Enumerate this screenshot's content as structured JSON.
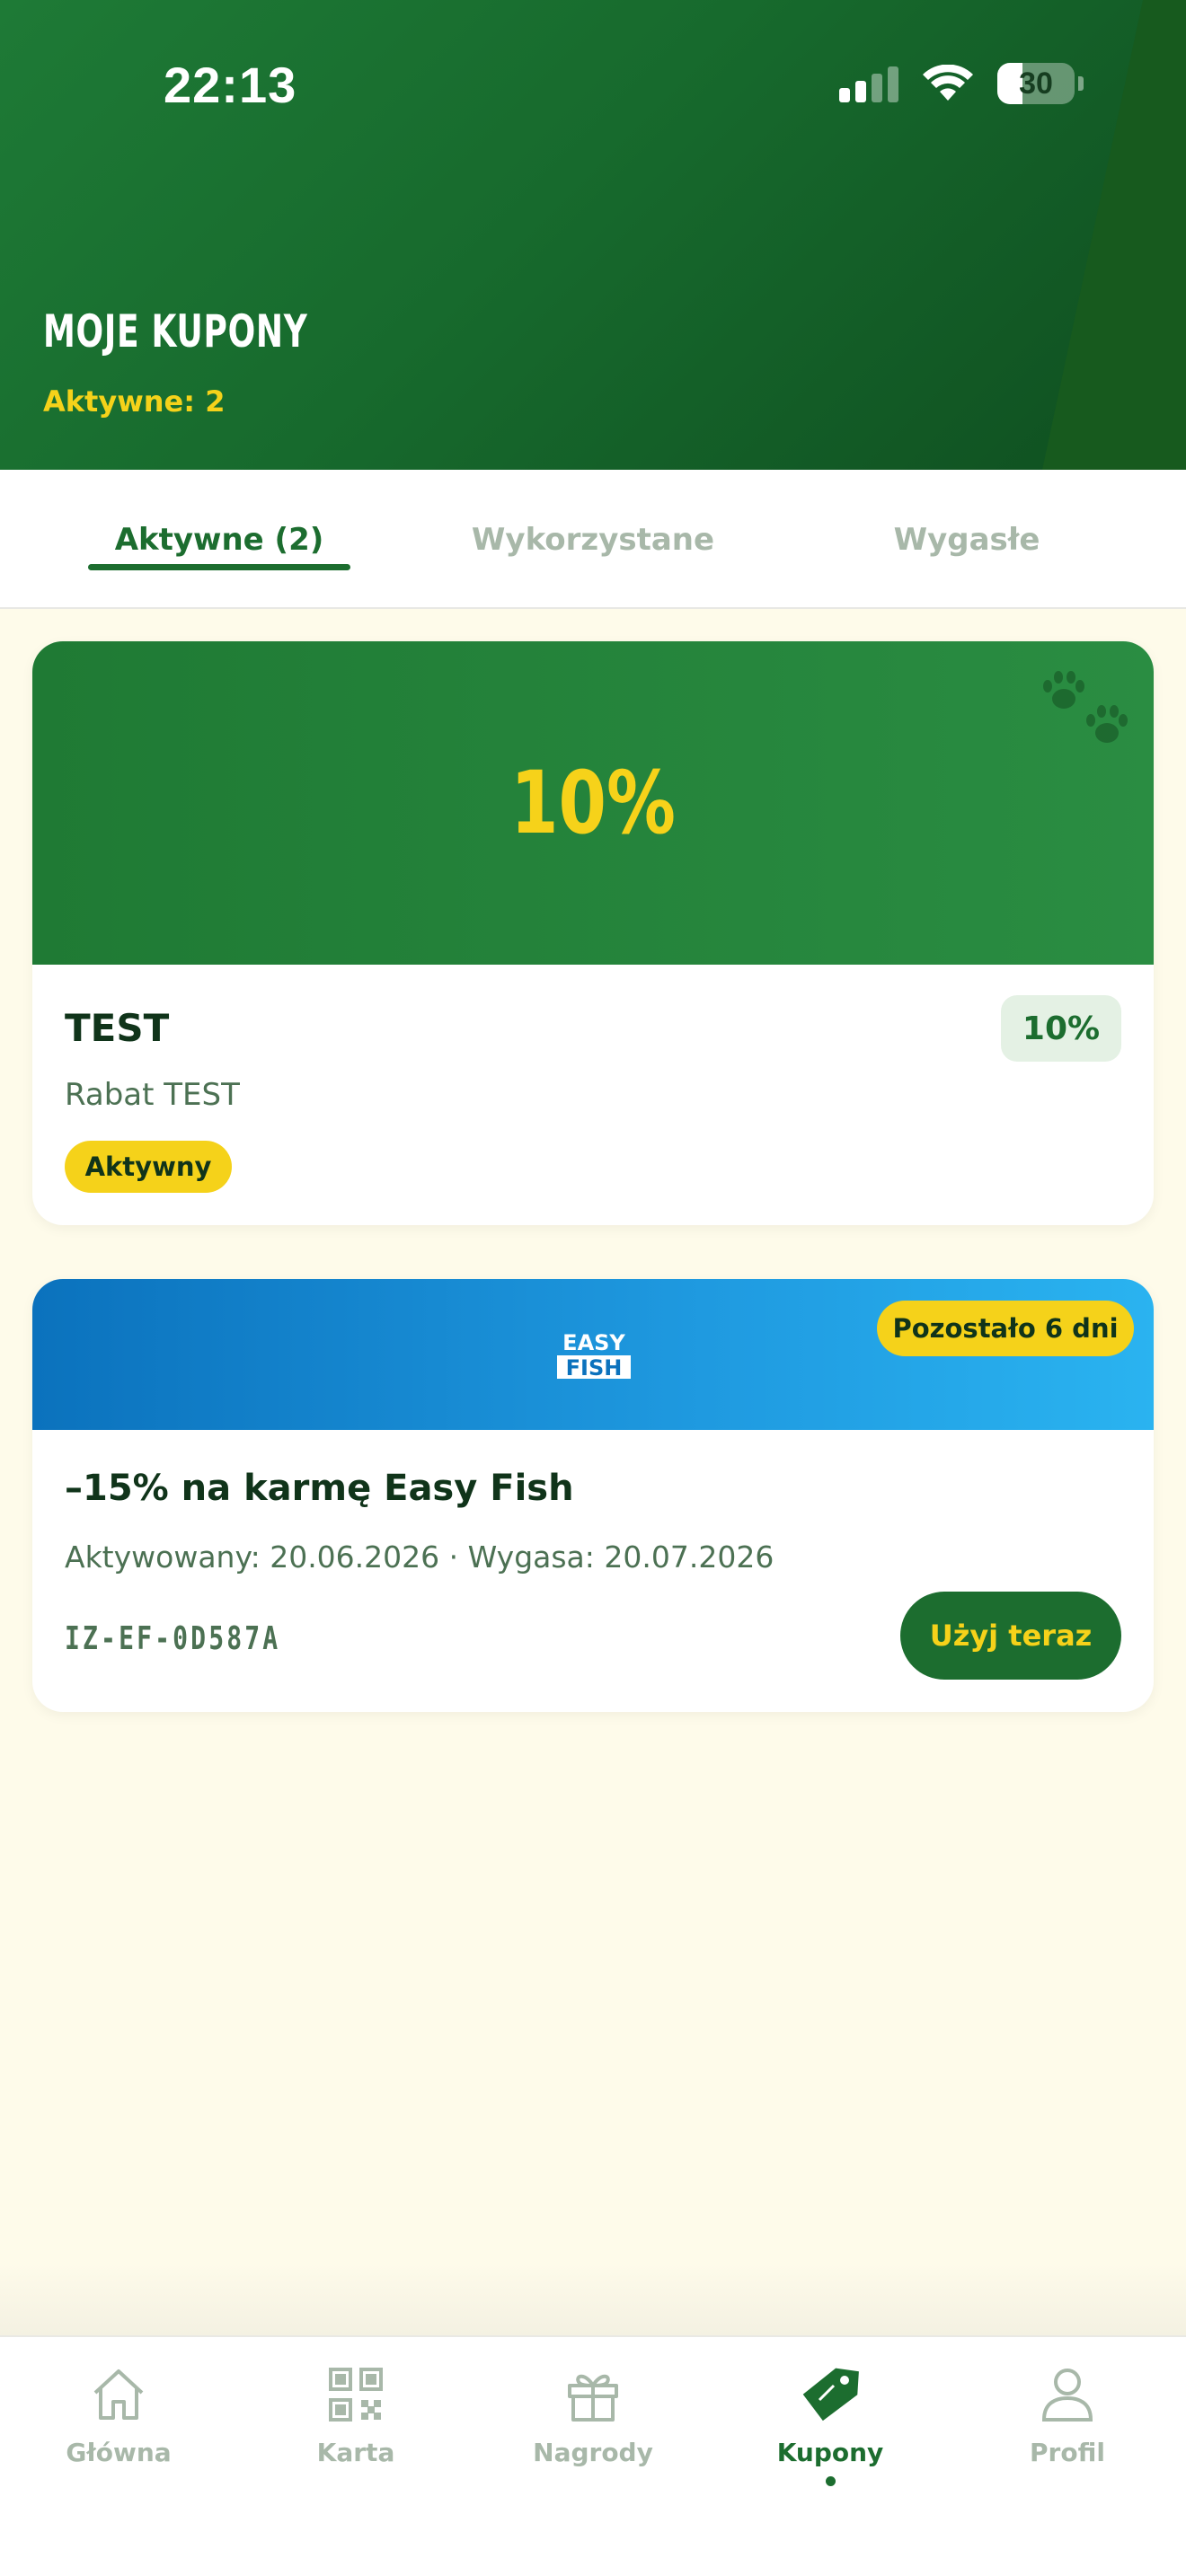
{
  "status_bar": {
    "time": "22:13",
    "battery": "30"
  },
  "header": {
    "title": "MOJE KUPONY",
    "subtitle": "Aktywne: 2"
  },
  "tabs": [
    {
      "label": "Aktywne (2)",
      "active": true
    },
    {
      "label": "Wykorzystane",
      "active": false
    },
    {
      "label": "Wygasłe",
      "active": false
    }
  ],
  "coupons": [
    {
      "hero_value": "10%",
      "title": "TEST",
      "description": "Rabat TEST",
      "discount_badge": "10%",
      "status": "Aktywny",
      "hero_color": "#1f7a34"
    },
    {
      "brand_logo_text": [
        "EASY",
        "FISH"
      ],
      "days_left": "Pozostało 6 dni",
      "title": "–15% na karmę Easy Fish",
      "description": "Aktywowany: 20.06.2026 · Wygasa: 20.07.2026",
      "code": "IZ-EF-0D587A",
      "action": "Użyj teraz",
      "hero_color": "#0b72bd"
    }
  ],
  "bottom_nav": [
    {
      "label": "Główna",
      "icon": "home-icon",
      "active": false
    },
    {
      "label": "Karta",
      "icon": "qr-code-icon",
      "active": false
    },
    {
      "label": "Nagrody",
      "icon": "gift-icon",
      "active": false
    },
    {
      "label": "Kupony",
      "icon": "tag-icon",
      "active": true
    },
    {
      "label": "Profil",
      "icon": "user-icon",
      "active": false
    }
  ],
  "colors": {
    "primary": "#1c6d2f",
    "accent": "#f5d21a",
    "background": "#fefbea",
    "inactive": "#a8b8a9"
  }
}
